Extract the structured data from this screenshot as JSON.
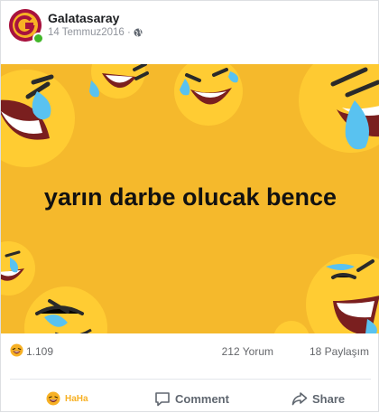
{
  "post": {
    "page_name": "Galatasaray",
    "date": "14 Temmuz2016 ·",
    "privacy_icon": "globe-icon",
    "media_text": "yarın darbe olucak bence",
    "reaction_icon": "haha-icon",
    "reaction_count": "1.109",
    "comments_text": "212 Yorum",
    "shares_text": "18 Paylaşım"
  },
  "actions": {
    "reaction_label": "HaHa",
    "comment_label": "Comment",
    "share_label": "Share"
  },
  "colors": {
    "background": "#f5b92c",
    "brand_red": "#a8123e",
    "brand_yellow": "#f7b125"
  }
}
